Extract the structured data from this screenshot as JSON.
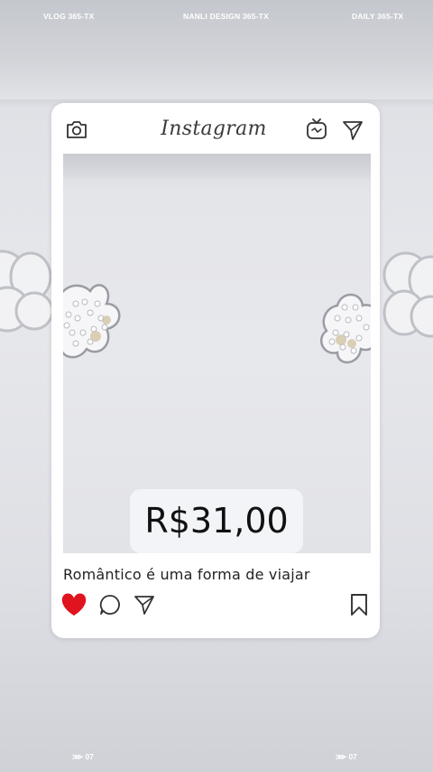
{
  "top_labels": {
    "left": "VLOG 365-TX",
    "center": "NANLI DESIGN 365-TX",
    "right": "DAILY 365-TX"
  },
  "bottom_labels": {
    "left": "⋙ 07",
    "right": "⋙ 07"
  },
  "card": {
    "logo_text": "Instagram",
    "price": "R$31,00",
    "caption": "Romântico é uma forma de viajar",
    "icons": {
      "camera": "camera-icon",
      "igtv": "igtv-icon",
      "direct": "send-icon",
      "like": "heart-icon",
      "comment": "comment-icon",
      "share": "send-icon",
      "save": "bookmark-icon"
    },
    "like_color": "#e0141e"
  }
}
